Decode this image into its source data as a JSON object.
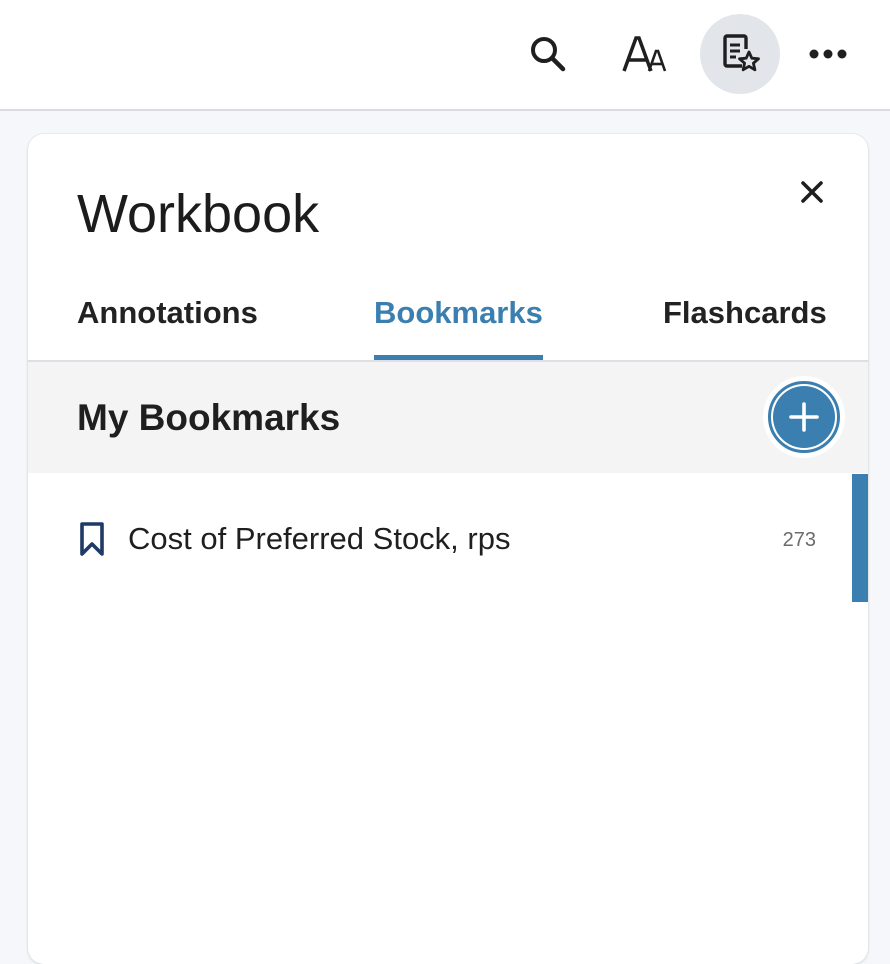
{
  "toolbar": {
    "search_icon": "search-icon",
    "font_size_icon": "font-size-icon",
    "workbook_icon": "workbook-icon",
    "more_icon": "more-icon",
    "accent_color": "#3a7fb0",
    "active_bg": "#e2e5ea"
  },
  "panel": {
    "title": "Workbook",
    "close_icon": "close-icon",
    "tabs": [
      {
        "label": "Annotations",
        "active": false
      },
      {
        "label": "Bookmarks",
        "active": true
      },
      {
        "label": "Flashcards",
        "active": false
      }
    ],
    "section": {
      "title": "My Bookmarks",
      "add_icon": "plus-icon"
    },
    "bookmarks": [
      {
        "label": "Cost of Preferred Stock, rps",
        "page": "273",
        "icon": "bookmark-icon"
      }
    ]
  }
}
